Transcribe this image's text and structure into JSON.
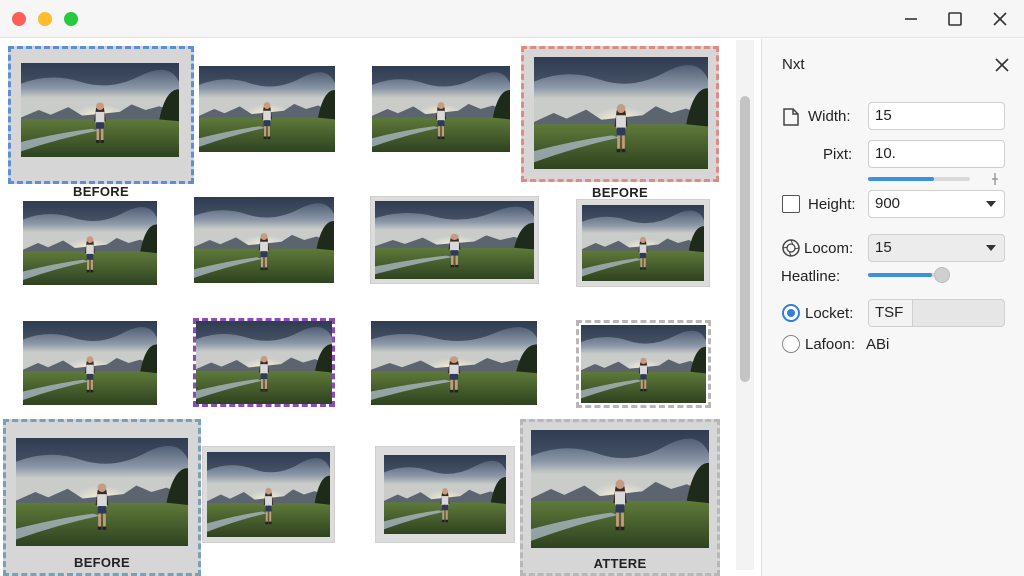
{
  "panel": {
    "title": "Nxt",
    "width": {
      "label": "Width:",
      "value": "15"
    },
    "pixel": {
      "label": "Pixt:",
      "value": "10.",
      "slider_fraction": 0.65
    },
    "height": {
      "label": "Height:",
      "value": "900"
    },
    "locom": {
      "label": "Locom:",
      "value": "15"
    },
    "headline": {
      "label": "Heatline:",
      "slider_fraction": 0.78
    },
    "locket": {
      "label": "Locket:",
      "value": "TSF"
    },
    "lafoon": {
      "label": "Lafoon:",
      "value": "ABi"
    }
  },
  "captions": {
    "before_1": "BEFORE",
    "before_2": "BEFORE",
    "before_3": "BEFORE",
    "after_1": "ATTERE"
  },
  "icons": {
    "width": "document-icon",
    "locom": "aperture-icon",
    "close": "close-icon"
  }
}
